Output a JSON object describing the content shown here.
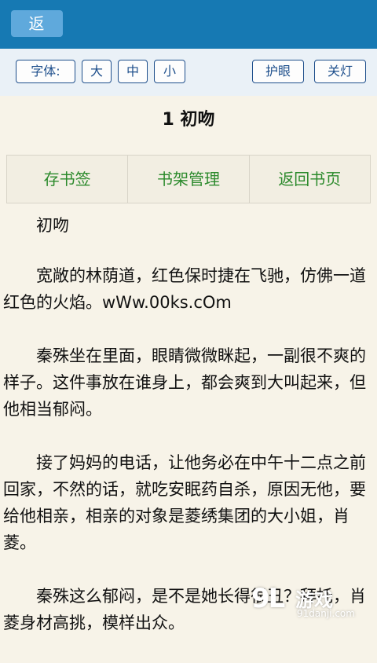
{
  "header": {
    "back_label": "返回",
    "bar_color": "#1679b3",
    "back_color": "#5fa9dc"
  },
  "toolbar": {
    "font_label": "字体:",
    "size_large": "大",
    "size_medium": "中",
    "size_small": "小",
    "eye_care": "护眼",
    "lights_off": "关灯"
  },
  "chapter": {
    "title": "1 初吻"
  },
  "nav": {
    "bookmark": "存书签",
    "shelf": "书架管理",
    "back_to_book": "返回书页"
  },
  "content": {
    "paragraphs": [
      "初吻",
      "宽敞的林荫道，红色保时捷在飞驰，仿佛一道红色的火焰。wWw.00ks.cOm",
      "秦殊坐在里面，眼睛微微眯起，一副很不爽的样子。这件事放在谁身上，都会爽到大叫起来，但他相当郁闷。",
      "接了妈妈的电话，让他务必在中午十二点之前回家，不然的话，就吃安眠药自杀，原因无他，要给他相亲，相亲的对象是菱绣集团的大小姐，肖菱。",
      "秦殊这么郁闷，是不是她长得很丑？拜托，肖菱身材高挑，模样出众。"
    ]
  },
  "watermark": {
    "logo": "9L",
    "name": "游戏",
    "url": "91danji.com"
  }
}
